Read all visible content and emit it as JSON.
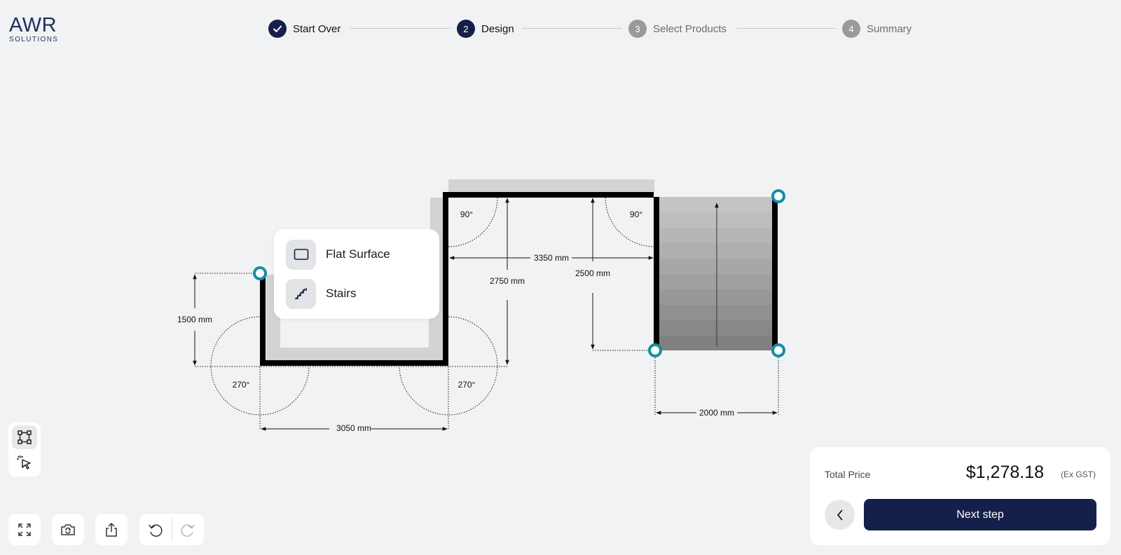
{
  "logo": {
    "brand": "AWR",
    "sub": "SOLUTIONS"
  },
  "stepper": {
    "steps": [
      {
        "num": "✓",
        "label": "Start Over"
      },
      {
        "num": "2",
        "label": "Design"
      },
      {
        "num": "3",
        "label": "Select Products"
      },
      {
        "num": "4",
        "label": "Summary"
      }
    ]
  },
  "plan": {
    "dimensions": {
      "left_height": "1500 mm",
      "bottom_width": "3050 mm",
      "top_width": "3350 mm",
      "middle_height": "2750 mm",
      "right_height": "2500 mm",
      "stairs_width": "2000 mm"
    },
    "angles": {
      "top_left": "90°",
      "top_right": "90°",
      "bottom_left": "270°",
      "bottom_right": "270°"
    }
  },
  "surface_menu": {
    "items": [
      {
        "label": "Flat Surface",
        "icon": "rectangle-icon"
      },
      {
        "label": "Stairs",
        "icon": "stairs-icon"
      }
    ]
  },
  "tools": {
    "items": [
      {
        "name": "shape-edit-icon",
        "selected": true
      },
      {
        "name": "select-cursor-icon",
        "selected": false
      }
    ]
  },
  "bottom_toolbar": {
    "buttons": [
      "expand-icon",
      "camera-switch-icon",
      "share-icon",
      "undo-icon",
      "redo-icon"
    ]
  },
  "price": {
    "label": "Total Price",
    "amount": "$1,278.18",
    "tax_note": "(Ex GST)",
    "next_label": "Next step"
  },
  "colors": {
    "accent": "#14204a",
    "handle": "#168ea3",
    "background": "#f1f2f4"
  }
}
